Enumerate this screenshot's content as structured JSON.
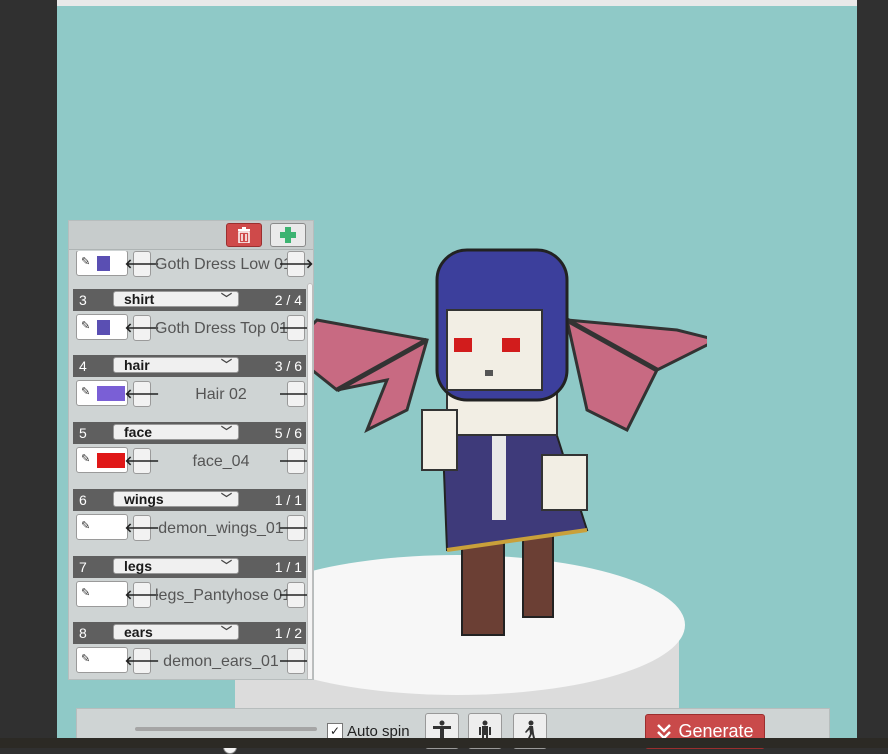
{
  "toolbar": {
    "delete_icon": "trash-icon",
    "add_icon": "plus-icon"
  },
  "parts": [
    {
      "index": "",
      "category": "",
      "count": "",
      "color": "#5a4fb3",
      "name": "Goth Dress Low 01"
    },
    {
      "index": "3",
      "category": "shirt",
      "count": "2 / 4",
      "color": "#5a4fb3",
      "name": "Goth Dress Top 01"
    },
    {
      "index": "4",
      "category": "hair",
      "count": "3 / 6",
      "color": "#7a5fd6",
      "name": "Hair 02"
    },
    {
      "index": "5",
      "category": "face",
      "count": "5 / 6",
      "color": "#e01818",
      "name": "face_04"
    },
    {
      "index": "6",
      "category": "wings",
      "count": "1 / 1",
      "color": "#ffffff",
      "name": "demon_wings_01"
    },
    {
      "index": "7",
      "category": "legs",
      "count": "1 / 1",
      "color": "#ffffff",
      "name": "legs_Pantyhose 01"
    },
    {
      "index": "8",
      "category": "ears",
      "count": "1 / 2",
      "color": "#ffffff",
      "name": "demon_ears_01"
    }
  ],
  "bottom": {
    "slider_value": 0.52,
    "autospin_label": "Auto spin",
    "autospin_checked": true,
    "generate_label": "Generate"
  },
  "colors": {
    "background": "#8fc9c7",
    "generate": "#c94a4a",
    "delete": "#cf4a4a",
    "add": "#3cb371"
  }
}
